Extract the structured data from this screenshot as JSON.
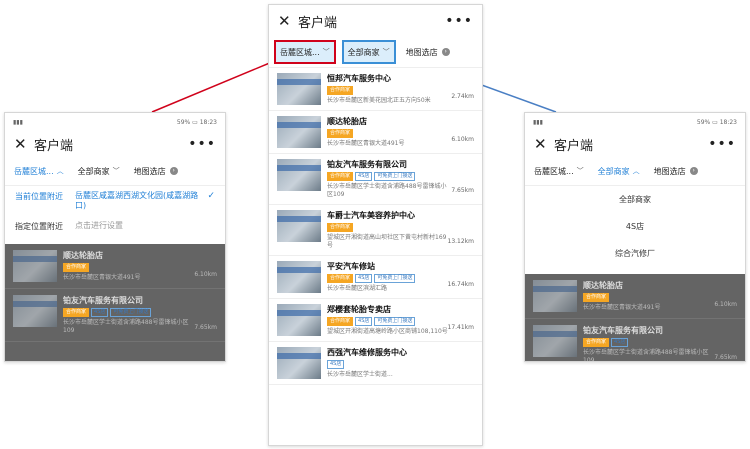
{
  "app": {
    "title": "客户端",
    "close_glyph": "✕",
    "more_glyph": "•••"
  },
  "status": {
    "battery": "59%",
    "time": "18:23"
  },
  "filters": {
    "region_center": "岳麓区城...",
    "region_side": "岳麓区城...",
    "category": "全部商家",
    "map": "地图选店"
  },
  "location_panel": {
    "current_label": "当前位置附近",
    "current_value": "岳麓区咸嘉湖西湖文化园(咸嘉湖路口)",
    "specify_label": "指定位置附近",
    "specify_value": "点击进行设置"
  },
  "category_options": [
    "全部商家",
    "4S店",
    "综合汽修厂"
  ],
  "shops": [
    {
      "name": "恒邦汽车服务中心",
      "tags": [
        "合作商家"
      ],
      "addr": "长沙市岳麓区新美花园北正五方向50米",
      "dist": "2.74km"
    },
    {
      "name": "顺达轮胎店",
      "tags": [
        "合作商家"
      ],
      "addr": "长沙市岳麓区青银大道491号",
      "dist": "6.10km"
    },
    {
      "name": "铂友汽车服务有限公司",
      "tags": [
        "合作商家",
        "4S店",
        "可免费上门接送"
      ],
      "addr": "长沙市岳麓区学士街道含浦路488号雷锋城小区109",
      "dist": "7.65km"
    },
    {
      "name": "车爵士汽车美容养护中心",
      "tags": [
        "合作商家"
      ],
      "addr": "望城区开湘街道高山坝社区下黄屯村新村169号",
      "dist": "13.12km"
    },
    {
      "name": "平安汽车修站",
      "tags": [
        "合作商家",
        "4S店",
        "可免费上门接送"
      ],
      "addr": "长沙市岳麓区滨湖汇路",
      "dist": "16.74km"
    },
    {
      "name": "郑樱套轮胎专卖店",
      "tags": [
        "合作商家",
        "4S店",
        "可免费上门接送"
      ],
      "addr": "望城区开湘街道高塘岭路小区商铺108,110号",
      "dist": "17.41km"
    },
    {
      "name": "西强汽车维修服务中心",
      "tags": [
        "4S店"
      ],
      "addr": "长沙市岳麓区学士街道...",
      "dist": ""
    }
  ],
  "side_shops": [
    {
      "name": "顺达轮胎店",
      "tags": [
        "合作商家"
      ],
      "addr": "长沙市岳麓区青银大道491号",
      "dist": "6.10km"
    },
    {
      "name": "铂友汽车服务有限公司",
      "tags": [
        "合作商家",
        "4S店",
        "可免费上门接送"
      ],
      "addr": "长沙市岳麓区学士街道含浦路488号雷锋城小区109",
      "dist": "7.65km"
    }
  ],
  "colors": {
    "accent": "#1f7fd6",
    "red_box": "#d0021b",
    "blue_box": "#3a8fd6",
    "tag_orange": "#f5a623"
  }
}
